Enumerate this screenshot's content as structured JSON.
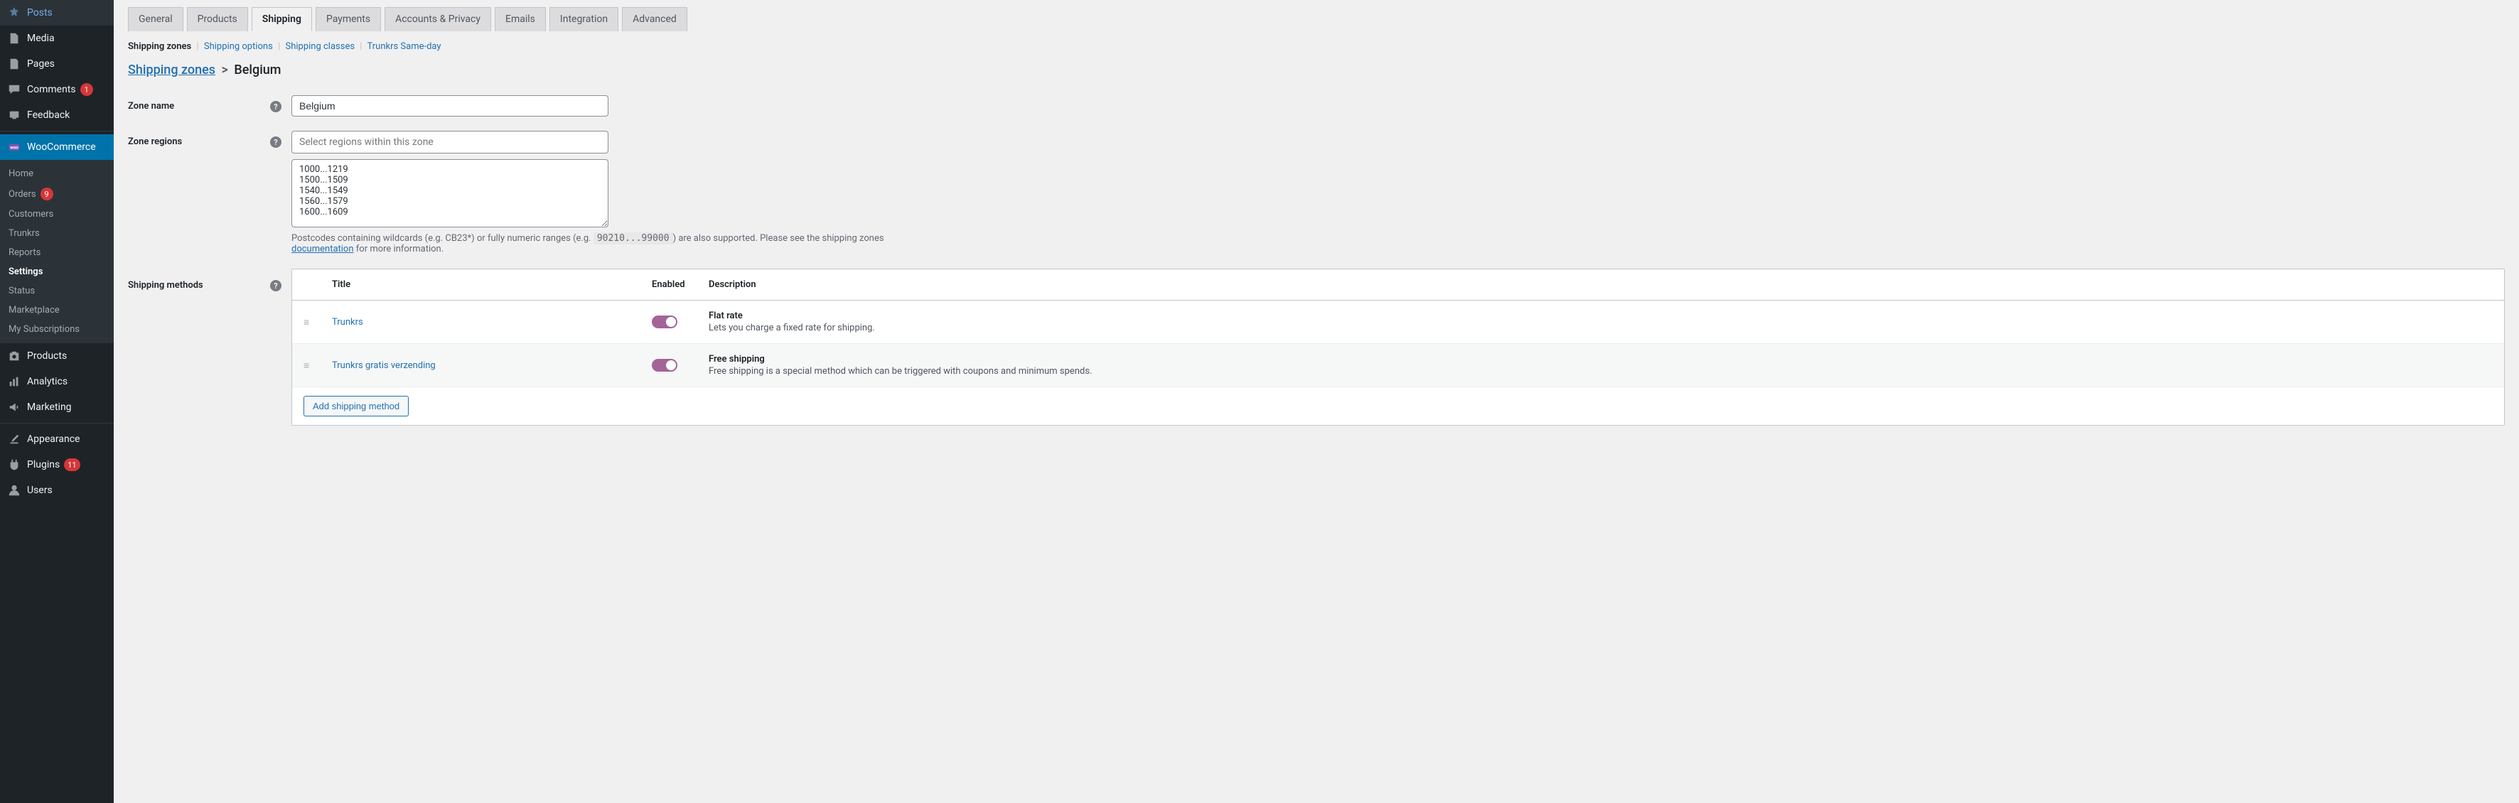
{
  "sidebar": {
    "items": [
      {
        "label": "Posts",
        "icon": "pin"
      },
      {
        "label": "Media",
        "icon": "media"
      },
      {
        "label": "Pages",
        "icon": "page"
      },
      {
        "label": "Comments",
        "icon": "comment",
        "badge": "1"
      },
      {
        "label": "Feedback",
        "icon": "feedback"
      },
      {
        "label": "WooCommerce",
        "icon": "woo",
        "active": true
      },
      {
        "label": "Products",
        "icon": "product"
      },
      {
        "label": "Analytics",
        "icon": "chart"
      },
      {
        "label": "Marketing",
        "icon": "megaphone"
      },
      {
        "label": "Appearance",
        "icon": "brush"
      },
      {
        "label": "Plugins",
        "icon": "plugin",
        "badge": "11"
      },
      {
        "label": "Users",
        "icon": "user"
      }
    ],
    "sub": [
      {
        "label": "Home"
      },
      {
        "label": "Orders",
        "badge": "9"
      },
      {
        "label": "Customers"
      },
      {
        "label": "Trunkrs"
      },
      {
        "label": "Reports"
      },
      {
        "label": "Settings",
        "active": true
      },
      {
        "label": "Status"
      },
      {
        "label": "Marketplace"
      },
      {
        "label": "My Subscriptions"
      }
    ]
  },
  "tabs": [
    {
      "label": "General"
    },
    {
      "label": "Products"
    },
    {
      "label": "Shipping",
      "active": true
    },
    {
      "label": "Payments"
    },
    {
      "label": "Accounts & Privacy"
    },
    {
      "label": "Emails"
    },
    {
      "label": "Integration"
    },
    {
      "label": "Advanced"
    }
  ],
  "subnav": {
    "current": "Shipping zones",
    "items": [
      "Shipping options",
      "Shipping classes",
      "Trunkrs Same-day"
    ]
  },
  "breadcrumb": {
    "parent": "Shipping zones",
    "current": "Belgium"
  },
  "fields": {
    "zone_name": {
      "label": "Zone name",
      "value": "Belgium"
    },
    "zone_regions": {
      "label": "Zone regions",
      "placeholder": "Select regions within this zone"
    },
    "postcodes": {
      "value": "1000...1219\n1500...1509\n1540...1549\n1560...1579\n1600...1609"
    },
    "help_pre": "Postcodes containing wildcards (e.g. CB23*) or fully numeric ranges (e.g. ",
    "help_code": "90210...99000",
    "help_post": ") are also supported. Please see the shipping zones ",
    "help_link": "documentation",
    "help_tail": " for more information.",
    "shipping_methods_label": "Shipping methods"
  },
  "methods": {
    "head": {
      "title": "Title",
      "enabled": "Enabled",
      "desc": "Description"
    },
    "rows": [
      {
        "title": "Trunkrs",
        "desc_title": "Flat rate",
        "desc_text": "Lets you charge a fixed rate for shipping."
      },
      {
        "title": "Trunkrs gratis verzending",
        "desc_title": "Free shipping",
        "desc_text": "Free shipping is a special method which can be triggered with coupons and minimum spends."
      }
    ],
    "add_label": "Add shipping method"
  }
}
